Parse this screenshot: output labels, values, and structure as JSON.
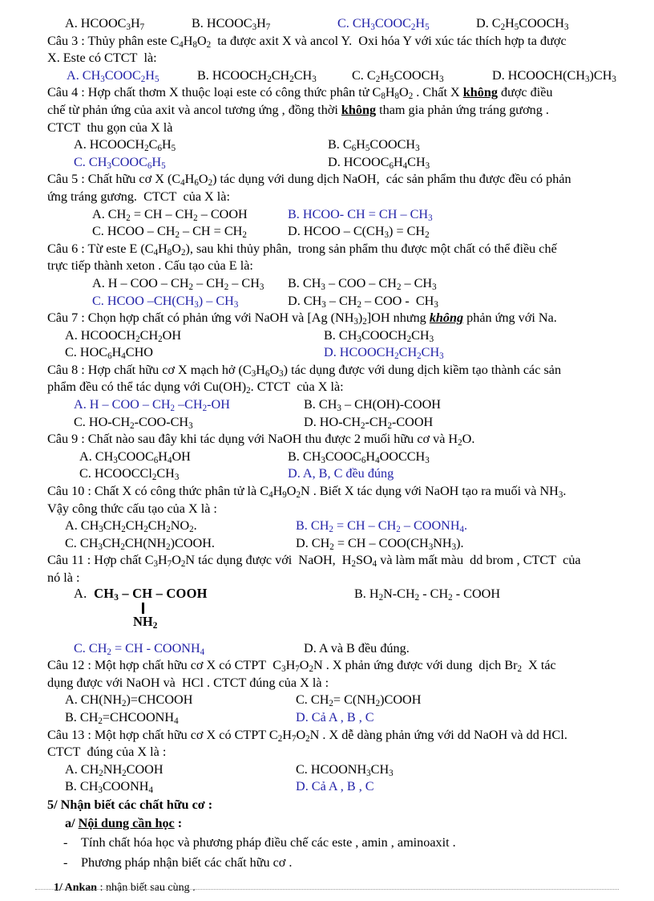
{
  "document": {
    "language": "vi",
    "accent_color": "#2323a8",
    "text_color": "#000000",
    "background": "#ffffff"
  },
  "q2_options": {
    "a": "A. HCOOC3H7",
    "b": "B. HCOOC3H7",
    "c": "C. CH3COOC2H5",
    "d": "D. C2H5COOCH3"
  },
  "q3": {
    "stem_line1": "Câu 3 : Thủy phân este C4H8O2  ta được axit X và ancol Y.  Oxi hóa Y với xúc tác thích hợp ta được",
    "stem_line2": "X. Este có CTCT  là:",
    "a": "A. CH3COOC2H5",
    "b": "B. HCOOCH2CH2CH3",
    "c": "C. C2H5COOCH3",
    "d": "D. HCOOCH(CH3)CH3"
  },
  "q4": {
    "stem_line1_p1": "Câu 4 : Hợp chất thơm X thuộc loại este có công thức phân tử C8H8O2 . Chất X ",
    "stem_line1_em": "không",
    "stem_line1_p2": " được điều",
    "stem_line2_p1": "chế từ phản ứng của axit và ancol tương ứng , đồng thời ",
    "stem_line2_em": "không",
    "stem_line2_p2": " tham gia phản ứng tráng gương .",
    "stem_line3": "CTCT  thu gọn của X là",
    "a": "A. HCOOCH2C6H5",
    "b": "B. C6H5COOCH3",
    "c": "C. CH3COOC6H5",
    "d": "D. HCOOC6H4CH3"
  },
  "q5": {
    "stem_line1": "Câu 5 : Chất hữu cơ X (C4H6O2) tác dụng với dung dịch NaOH,  các sản phẩm thu được đều có phản",
    "stem_line2": "ứng tráng gương.  CTCT  của X là:",
    "a": "A. CH2 = CH – CH2 – COOH",
    "b": "B. HCOO- CH = CH – CH3",
    "c": "C. HCOO – CH2 – CH = CH2",
    "d": "D. HCOO – C(CH3) = CH2"
  },
  "q6": {
    "stem_line1": "Câu 6 : Từ este E (C4H8O2), sau khi thủy phân,  trong sản phẩm thu được một chất có thể điều chế",
    "stem_line2": "trực tiếp thành xeton . Cấu tạo của E là:",
    "a": "A. H – COO – CH2 – CH2 – CH3",
    "b": "B. CH3 – COO – CH2 – CH3",
    "c": "C. HCOO –CH(CH3) – CH3",
    "d": "D. CH3 – CH2 – COO -  CH3"
  },
  "q7": {
    "stem_p1": "Câu 7 : Chọn hợp chất có phản ứng với NaOH và [Ag (NH3)2]OH nhưng ",
    "stem_em": "không",
    "stem_p2": " phản ứng với Na.",
    "a": "A. HCOOCH2CH2OH",
    "b": "B. CH3COOCH2CH3",
    "c": "C. HOC6H4CHO",
    "d": "D. HCOOCH2CH2CH3"
  },
  "q8": {
    "stem_line1": "Câu 8 : Hợp chất hữu cơ X mạch hở (C3H6O3) tác dụng được với dung dịch kiềm tạo thành các sản",
    "stem_line2": "phẩm đều có thể tác dụng với Cu(OH)2. CTCT  của X là:",
    "a": "A. H – COO – CH2 –CH2-OH",
    "b": "B. CH3 – CH(OH)-COOH",
    "c": "C. HO-CH2-COO-CH3",
    "d": "D. HO-CH2-CH2-COOH"
  },
  "q9": {
    "stem": "Câu 9 : Chất nào sau đây khi tác dụng với NaOH thu được 2 muối hữu cơ và H2O.",
    "a": "A. CH3COOC6H4OH",
    "b": "B. CH3COOC6H4OOCCH3",
    "c": "C. HCOOCCl2CH3",
    "d": "D. A, B, C đều đúng"
  },
  "q10": {
    "stem_line1": "Câu 10 : Chất X có công thức phân tử là C4H9O2N . Biết X tác dụng với NaOH tạo ra muối và NH3.",
    "stem_line2": "Vậy công thức cấu tạo của X là :",
    "a": "A. CH3CH2CH2CH2NO2.",
    "b": "B. CH2 = CH – CH2 – COONH4.",
    "c": "C. CH3CH2CH(NH2)COOH.",
    "d": "D. CH2 = CH – COO(CH3NH3)."
  },
  "q11": {
    "stem_line1": "Câu 11 : Hợp chất C3H7O2N tác dụng được với  NaOH,  H2SO4 và làm mất màu dd brom , CTCT  của",
    "stem_line2": "nó là :",
    "a_label": "A.",
    "a_main": "CH3 – CH – COOH",
    "a_branch": "NH2",
    "b": "B. H2N-CH2 - CH2 - COOH",
    "c": "C. CH2 = CH - COONH4",
    "d": "D. A và B đều đúng."
  },
  "q12": {
    "stem_line1": "Câu 12 : Một hợp chất hữu cơ X có CTPT  C3H7O2N . X phản ứng được với dung  dịch Br2  X tác",
    "stem_line2": "dụng được với NaOH và  HCl . CTCT đúng của X là :",
    "a": "A. CH(NH2)=CHCOOH",
    "b": "B. CH2=CHCOONH4",
    "c": "C. CH2= C(NH2)COOH",
    "d": "D. Cả A , B , C"
  },
  "q13": {
    "stem_line1": "Câu 13 : Một hợp chất hữu cơ X có CTPT C2H7O2N . X dễ dàng phản ứng với dd NaOH và dd HCl.",
    "stem_line2": "CTCT  đúng của X là :",
    "a": "A. CH2NH2COOH",
    "b": "B. CH3COONH4",
    "c": "C. HCOONH3CH3",
    "d": "D. Cả A , B , C"
  },
  "section5": {
    "heading": "5/ Nhận biết các chất hữu cơ :",
    "sub_prefix": "a/ ",
    "sub_underlined": "Nội dung cần học",
    "sub_suffix": " :",
    "bullets": [
      "Tính chất hóa học và phương pháp điều chế các este , amin , aminoaxit .",
      "Phương pháp nhận biết các chất hữu cơ ."
    ],
    "item1_label": "1/  Ankan",
    "item1_text": " : nhận biết sau cùng ."
  }
}
